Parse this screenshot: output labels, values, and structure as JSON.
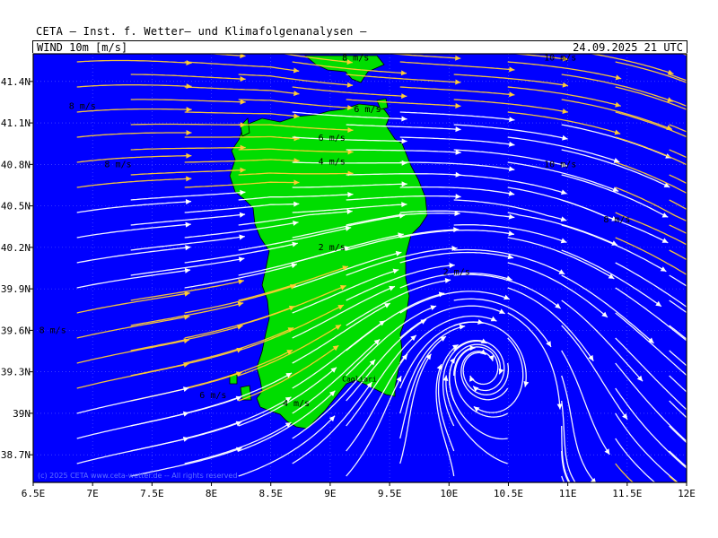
{
  "header": {
    "institute": "CETA – Inst. f. Wetter– und Klimafolgenanalysen –",
    "product": "WIND 10m [m/s]",
    "datetime": "24.09.2025 21 UTC"
  },
  "map": {
    "extent": {
      "lon_min": 6.5,
      "lon_max": 12.0,
      "lat_min": 38.5,
      "lat_max": 41.6
    },
    "colors": {
      "sea": "#0000ff",
      "land": "#00dd00",
      "streamline_slow": "#ffffff",
      "streamline_fast": "#ffcc33",
      "grid": "#6060ff"
    },
    "x_ticks": [
      "6.5E",
      "7E",
      "7.5E",
      "8E",
      "8.5E",
      "9E",
      "9.5E",
      "10E",
      "10.5E",
      "11E",
      "11.5E",
      "12E"
    ],
    "x_tick_values": [
      6.5,
      7,
      7.5,
      8,
      8.5,
      9,
      9.5,
      10,
      10.5,
      11,
      11.5,
      12
    ],
    "y_ticks": [
      "41.4N",
      "41.1N",
      "40.8N",
      "40.5N",
      "40.2N",
      "39.9N",
      "39.6N",
      "39.3N",
      "39N",
      "38.7N"
    ],
    "y_tick_values": [
      41.4,
      41.1,
      40.8,
      40.5,
      40.2,
      39.9,
      39.6,
      39.3,
      39.0,
      38.7
    ],
    "speed_labels": [
      {
        "text": "8 m/s",
        "lon": 9.1,
        "lat": 41.55
      },
      {
        "text": "10 m/s",
        "lon": 10.8,
        "lat": 41.55
      },
      {
        "text": "8 m/s",
        "lon": 6.8,
        "lat": 41.2
      },
      {
        "text": "6 m/s",
        "lon": 9.2,
        "lat": 41.18
      },
      {
        "text": "6 m/s",
        "lon": 8.9,
        "lat": 40.97
      },
      {
        "text": "4 m/s",
        "lon": 8.9,
        "lat": 40.8
      },
      {
        "text": "8 m/s",
        "lon": 7.1,
        "lat": 40.78
      },
      {
        "text": "10 m/s",
        "lon": 10.8,
        "lat": 40.78
      },
      {
        "text": "8 m/s",
        "lon": 11.3,
        "lat": 40.38
      },
      {
        "text": "2 m/s",
        "lon": 8.9,
        "lat": 40.18
      },
      {
        "text": "2 m/s",
        "lon": 9.95,
        "lat": 40.0
      },
      {
        "text": "8 m/s",
        "lon": 6.55,
        "lat": 39.58
      },
      {
        "text": "6 m/s",
        "lon": 7.9,
        "lat": 39.11
      },
      {
        "text": "4 m/s",
        "lon": 8.6,
        "lat": 39.05
      }
    ],
    "cities": [
      {
        "name": "Cagliari",
        "lon": 9.1,
        "lat": 39.23
      }
    ],
    "copyright": "(c) 2025 CETA www.ceta-wetter.de  --  All rights reserved"
  }
}
